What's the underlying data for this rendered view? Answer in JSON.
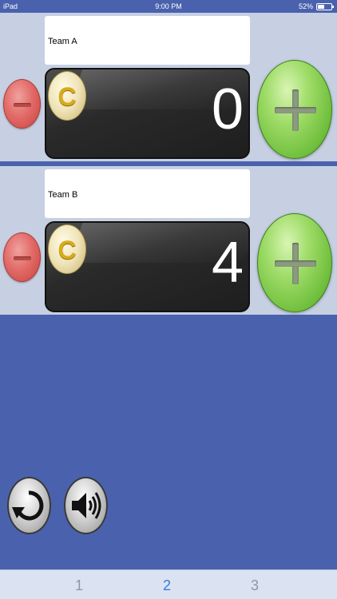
{
  "status_bar": {
    "carrier": "iPad",
    "time": "9:00 PM",
    "battery": "52%",
    "battery_level": 0.52
  },
  "teams": [
    {
      "name": "Team A",
      "score": "0",
      "coin_letter": "C"
    },
    {
      "name": "Team B",
      "score": "4",
      "coin_letter": "C"
    }
  ],
  "controls": {
    "reset_icon": "reset-icon",
    "sound_icon": "speaker-icon"
  },
  "tabs": [
    {
      "label": "1",
      "active": false
    },
    {
      "label": "2",
      "active": true
    },
    {
      "label": "3",
      "active": false
    }
  ],
  "colors": {
    "background": "#4a62ad",
    "panel": "#c6d0e2",
    "tab_active": "#2f7de0",
    "tab_inactive": "#8f96a6"
  }
}
